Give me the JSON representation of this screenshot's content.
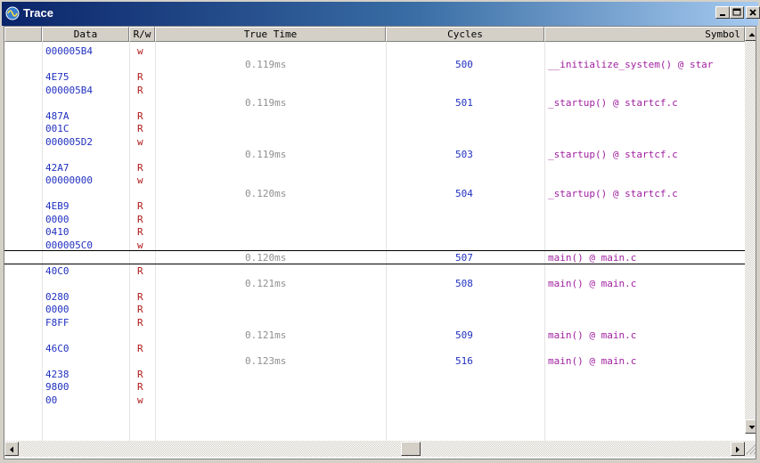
{
  "window": {
    "title": "Trace",
    "icon": "trace-app-icon",
    "buttons": {
      "minimize": "minimize-icon",
      "maximize": "maximize-icon",
      "close": "close-icon"
    }
  },
  "columns": [
    {
      "label": ""
    },
    {
      "label": "Data"
    },
    {
      "label": "R/w"
    },
    {
      "label": "True Time"
    },
    {
      "label": "Cycles"
    },
    {
      "label": "Symbol"
    }
  ],
  "rows": [
    {
      "data": "000005B4",
      "rw": "w",
      "time": "",
      "cycles": "",
      "symbol": ""
    },
    {
      "data": "",
      "rw": "",
      "time": "0.119ms",
      "cycles": "500",
      "symbol": "__initialize_system() @ star"
    },
    {
      "data": "4E75",
      "rw": "R",
      "time": "",
      "cycles": "",
      "symbol": ""
    },
    {
      "data": "000005B4",
      "rw": "R",
      "time": "",
      "cycles": "",
      "symbol": ""
    },
    {
      "data": "",
      "rw": "",
      "time": "0.119ms",
      "cycles": "501",
      "symbol": "_startup() @ startcf.c"
    },
    {
      "data": "487A",
      "rw": "R",
      "time": "",
      "cycles": "",
      "symbol": ""
    },
    {
      "data": "001C",
      "rw": "R",
      "time": "",
      "cycles": "",
      "symbol": ""
    },
    {
      "data": "000005D2",
      "rw": "w",
      "time": "",
      "cycles": "",
      "symbol": ""
    },
    {
      "data": "",
      "rw": "",
      "time": "0.119ms",
      "cycles": "503",
      "symbol": "_startup() @ startcf.c"
    },
    {
      "data": "42A7",
      "rw": "R",
      "time": "",
      "cycles": "",
      "symbol": ""
    },
    {
      "data": "00000000",
      "rw": "w",
      "time": "",
      "cycles": "",
      "symbol": ""
    },
    {
      "data": "",
      "rw": "",
      "time": "0.120ms",
      "cycles": "504",
      "symbol": "_startup() @ startcf.c"
    },
    {
      "data": "4EB9",
      "rw": "R",
      "time": "",
      "cycles": "",
      "symbol": ""
    },
    {
      "data": "0000",
      "rw": "R",
      "time": "",
      "cycles": "",
      "symbol": ""
    },
    {
      "data": "0410",
      "rw": "R",
      "time": "",
      "cycles": "",
      "symbol": ""
    },
    {
      "data": "000005C0",
      "rw": "w",
      "time": "",
      "cycles": "",
      "symbol": ""
    },
    {
      "data": "",
      "rw": "",
      "time": "0.120ms",
      "cycles": "507",
      "symbol": "main() @ main.c",
      "selected": true
    },
    {
      "data": "40C0",
      "rw": "R",
      "time": "",
      "cycles": "",
      "symbol": ""
    },
    {
      "data": "",
      "rw": "",
      "time": "0.121ms",
      "cycles": "508",
      "symbol": "main() @ main.c"
    },
    {
      "data": "0280",
      "rw": "R",
      "time": "",
      "cycles": "",
      "symbol": ""
    },
    {
      "data": "0000",
      "rw": "R",
      "time": "",
      "cycles": "",
      "symbol": ""
    },
    {
      "data": "F8FF",
      "rw": "R",
      "time": "",
      "cycles": "",
      "symbol": ""
    },
    {
      "data": "",
      "rw": "",
      "time": "0.121ms",
      "cycles": "509",
      "symbol": "main() @ main.c"
    },
    {
      "data": "46C0",
      "rw": "R",
      "time": "",
      "cycles": "",
      "symbol": ""
    },
    {
      "data": "",
      "rw": "",
      "time": "0.123ms",
      "cycles": "516",
      "symbol": "main() @ main.c"
    },
    {
      "data": "4238",
      "rw": "R",
      "time": "",
      "cycles": "",
      "symbol": ""
    },
    {
      "data": "9800",
      "rw": "R",
      "time": "",
      "cycles": "",
      "symbol": ""
    },
    {
      "data": "00",
      "rw": "w",
      "time": "",
      "cycles": "",
      "symbol": ""
    }
  ],
  "colors": {
    "data": "#2030c0",
    "rw": "#b01818",
    "time": "#909090",
    "cycles": "#2030c0",
    "symbol": "#a020a0"
  },
  "scrollbars": {
    "up": "scroll-up-arrow-icon",
    "down": "scroll-down-arrow-icon",
    "left": "scroll-left-arrow-icon",
    "right": "scroll-right-arrow-icon"
  }
}
